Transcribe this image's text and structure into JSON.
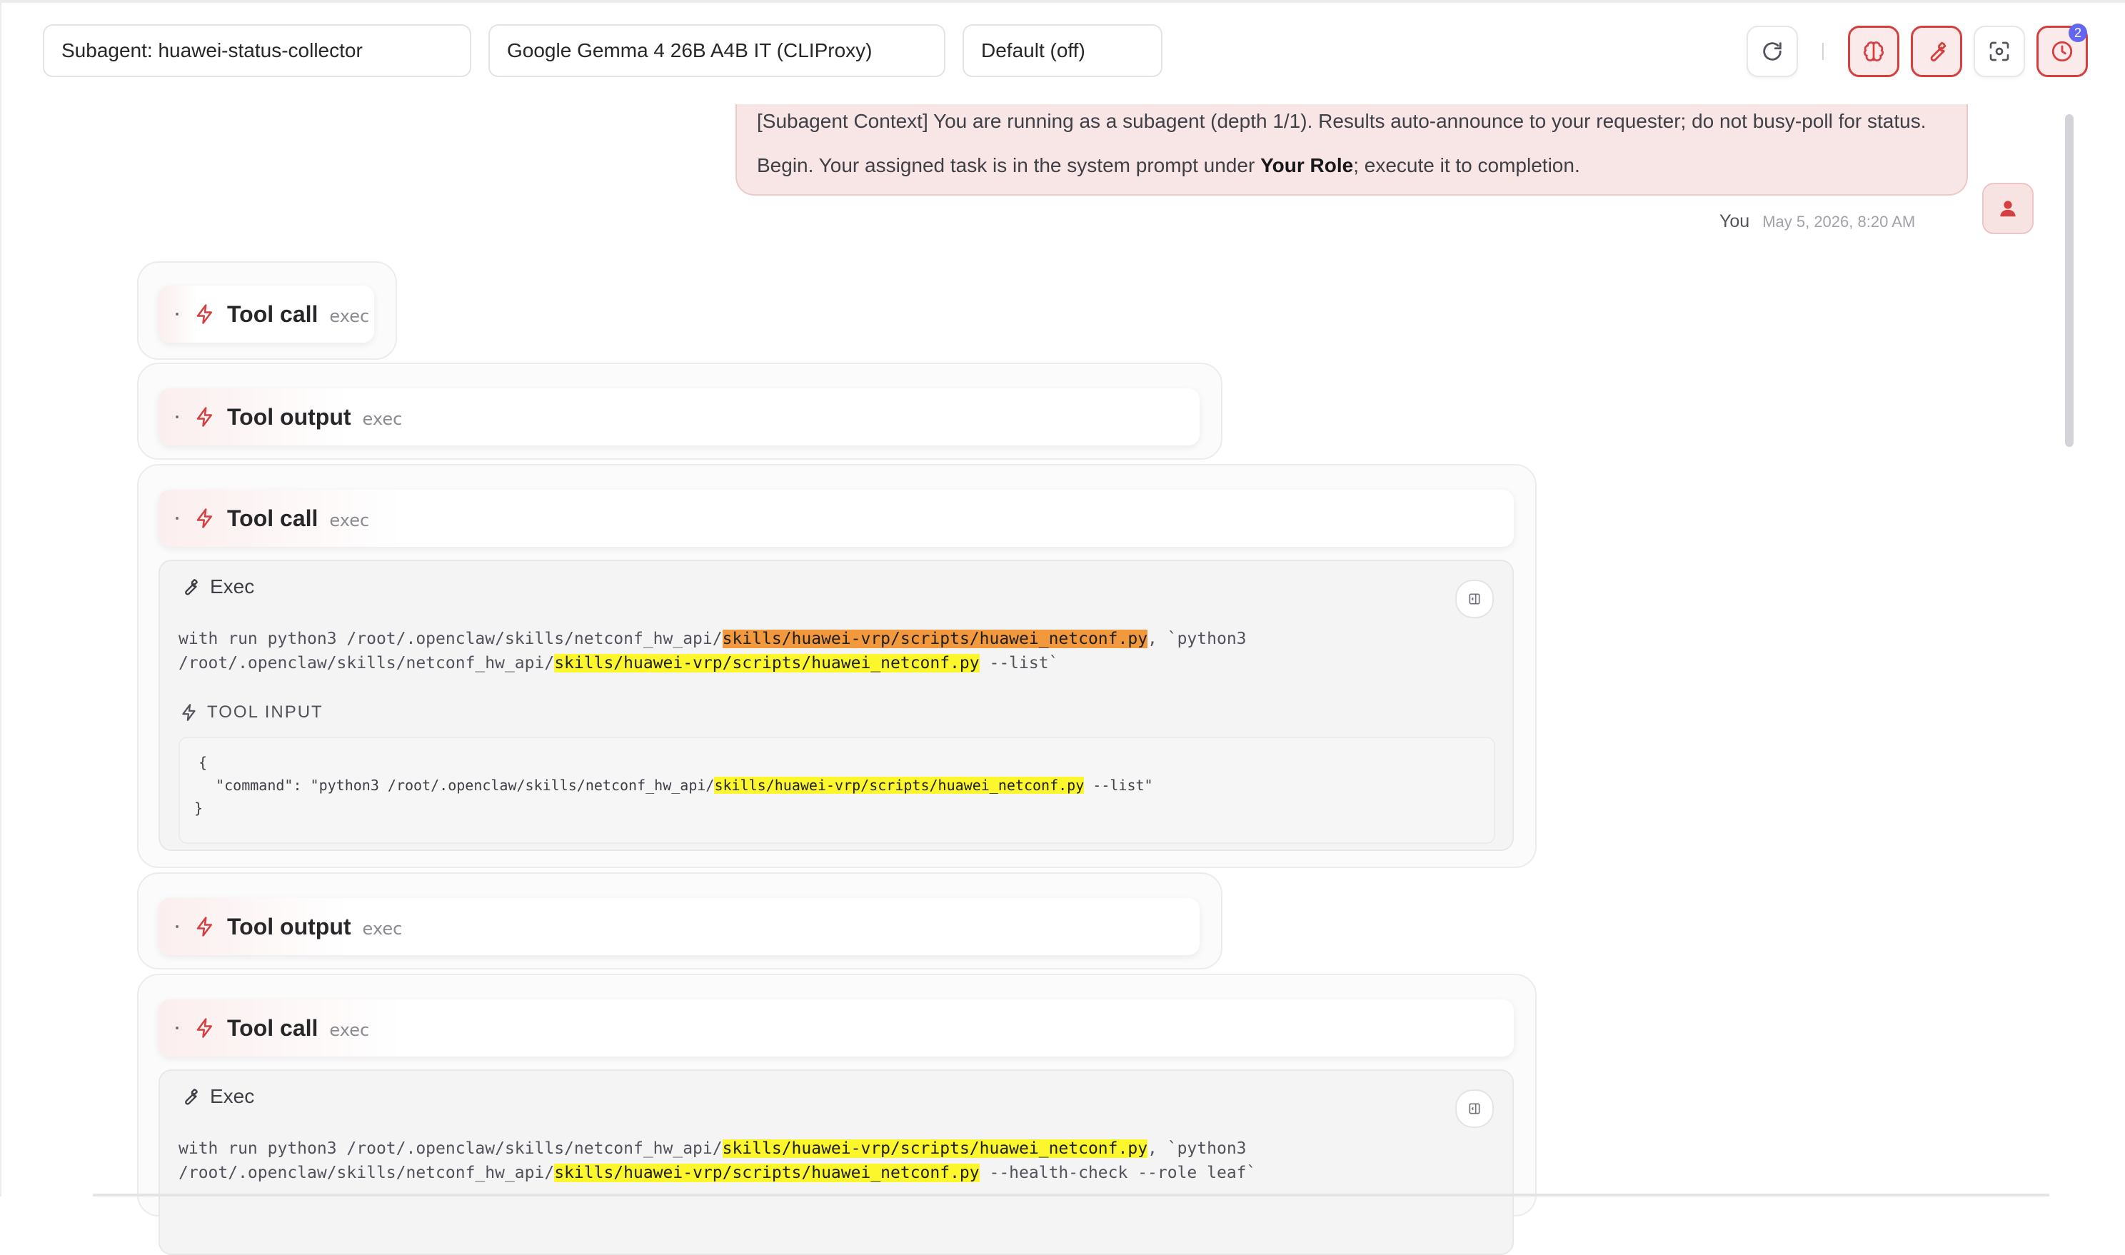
{
  "toolbar": {
    "agent_select": "Subagent: huawei-status-collector",
    "model_select": "Google Gemma 4 26B A4B IT (CLIProxy)",
    "thinking_select": "Default (off)",
    "history_badge": "2",
    "icons": [
      "refresh-icon",
      "brain-icon",
      "wrench-icon",
      "focus-icon",
      "history-icon"
    ]
  },
  "user_message": {
    "line1": "[Subagent Context] You are running as a subagent (depth 1/1). Results auto-announce to your requester; do not busy-poll for status.",
    "line2_before": "Begin. Your assigned task is in the system prompt under ",
    "line2_bold": "Your Role",
    "line2_after": "; execute it to completion.",
    "author": "You",
    "timestamp": "May 5, 2026, 8:20 AM"
  },
  "tool_items": [
    {
      "label": "Tool call",
      "sub": "exec"
    },
    {
      "label": "Tool output",
      "sub": "exec"
    },
    {
      "label": "Tool call",
      "sub": "exec"
    },
    {
      "label": "Tool output",
      "sub": "exec"
    },
    {
      "label": "Tool call",
      "sub": "exec"
    }
  ],
  "exec1": {
    "title": "Exec",
    "line1_pre": "with run python3 /root/.openclaw/skills/netconf_hw_api/",
    "line1_hl": "skills/huawei-vrp/scripts/huawei_netconf.py",
    "line1_post": ", `python3",
    "line2_pre": "/root/.openclaw/skills/netconf_hw_api/",
    "line2_hl": "skills/huawei-vrp/scripts/huawei_netconf.py",
    "line2_post": " --list`",
    "tool_input_label": "TOOL INPUT",
    "json_open": "{",
    "json_pre": "  \"command\": \"python3 /root/.openclaw/skills/netconf_hw_api/",
    "json_hl": "skills/huawei-vrp/scripts/huawei_netconf.py",
    "json_post": " --list\"",
    "json_close": "}"
  },
  "exec2": {
    "title": "Exec",
    "line1_pre": "with run python3 /root/.openclaw/skills/netconf_hw_api/",
    "line1_hl": "skills/huawei-vrp/scripts/huawei_netconf.py",
    "line1_post": ", `python3",
    "line2_pre": "/root/.openclaw/skills/netconf_hw_api/",
    "line2_hl": "skills/huawei-vrp/scripts/huawei_netconf.py",
    "line2_post": " --health-check --role leaf`"
  }
}
